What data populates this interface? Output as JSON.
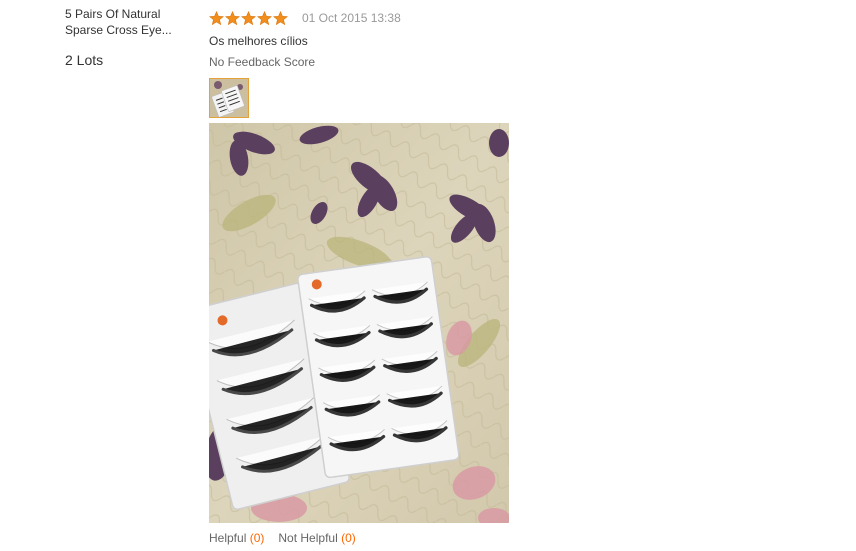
{
  "product": {
    "name": "5 Pairs Of Natural Sparse Cross Eye...",
    "quantity": "2 Lots"
  },
  "review": {
    "rating": 5,
    "rating_max": 5,
    "date": "01 Oct 2015 13:38",
    "text": "Os melhores cílios",
    "feedback_score": "No Feedback Score"
  },
  "actions": {
    "helpful_label": "Helpful",
    "helpful_count": "(0)",
    "not_helpful_label": "Not Helpful",
    "not_helpful_count": "(0)"
  },
  "colors": {
    "star": "#f28f1c",
    "date": "#999999",
    "count_accent": "#ff6600",
    "thumb_border": "#e5a13a"
  },
  "icons": {
    "star": "star-icon"
  }
}
